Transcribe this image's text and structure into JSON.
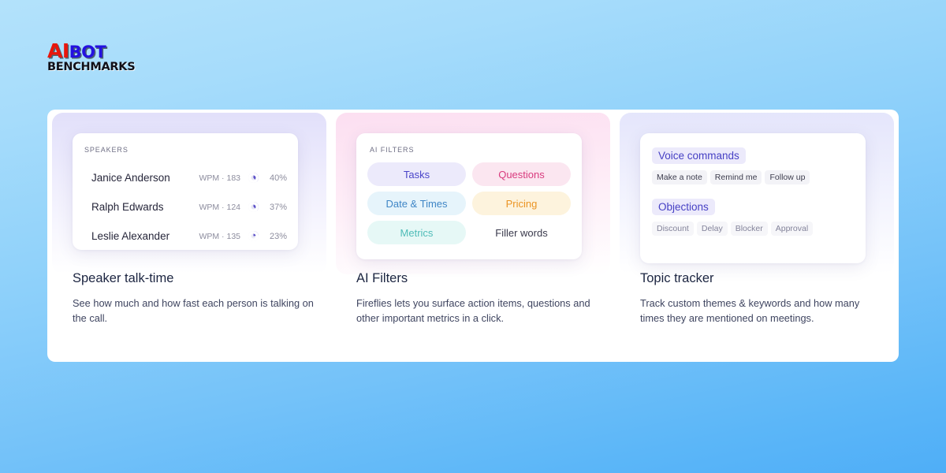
{
  "logo": {
    "part_ai": "AI",
    "part_bot": "BOT",
    "part_benchmarks": "BENCHMARKS",
    "color_ai": "#e8160c",
    "color_bot": "#2411e0",
    "color_benchmarks": "#111018"
  },
  "background": {
    "gradient_from": "#b3e2fb",
    "gradient_to": "#4faef7"
  },
  "panel": {
    "background": "#ffffff",
    "columns": [
      {
        "id": "speaker-talk-time",
        "wash_color": "#e0defa",
        "eyebrow": "SPEAKERS",
        "speakers": [
          {
            "name": "Janice Anderson",
            "wpm_label": "WPM · 183",
            "wpm": 183,
            "percent_label": "40%",
            "percent": 40
          },
          {
            "name": "Ralph Edwards",
            "wpm_label": "WPM · 124",
            "wpm": 124,
            "percent_label": "37%",
            "percent": 37
          },
          {
            "name": "Leslie Alexander",
            "wpm_label": "WPM · 135",
            "wpm": 135,
            "percent_label": "23%",
            "percent": 23
          }
        ],
        "donut_color": "#5b50c8",
        "donut_track": "#e6e5f4",
        "caption_title": "Speaker talk-time",
        "caption_body": "See how much and how fast each person is talking on the call."
      },
      {
        "id": "ai-filters",
        "wash_color": "#fcddf0",
        "eyebrow": "AI FILTERS",
        "filters": [
          {
            "label": "Tasks",
            "text_color": "#4a45c9",
            "bg_color": "#eceafb"
          },
          {
            "label": "Questions",
            "text_color": "#d93b7e",
            "bg_color": "#fbe6f0"
          },
          {
            "label": "Date & Times",
            "text_color": "#3f86c6",
            "bg_color": "#e6f4fb"
          },
          {
            "label": "Pricing",
            "text_color": "#eb9423",
            "bg_color": "#fdf3dd"
          },
          {
            "label": "Metrics",
            "text_color": "#4fbcb8",
            "bg_color": "#e6f8f6"
          },
          {
            "label": "Filler words",
            "text_color": "#3a3a4c",
            "bg_color": "#ffffff"
          }
        ],
        "caption_title": "AI Filters",
        "caption_body": "Fireflies lets you surface action items, questions and other important metrics in a click."
      },
      {
        "id": "topic-tracker",
        "wash_color": "#e3e4fb",
        "topics": [
          {
            "title": "Voice commands",
            "tags": [
              "Make a note",
              "Remind me",
              "Follow up"
            ]
          },
          {
            "title": "Objections",
            "tags": [
              "Discount",
              "Delay",
              "Blocker",
              "Approval"
            ]
          }
        ],
        "topic_title_color": "#4640c4",
        "caption_title": "Topic tracker",
        "caption_body": "Track custom themes & keywords and how many times they are mentioned on meetings."
      }
    ]
  }
}
